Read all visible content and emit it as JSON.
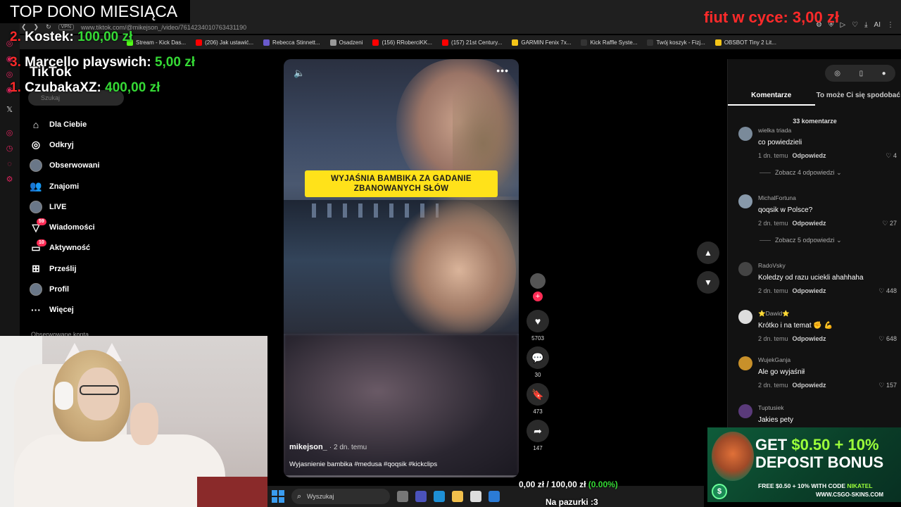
{
  "browser": {
    "url": "www.tiktok.com/@mikejson_/video/7614234010763431190",
    "vpn": "VPN",
    "bookmarks": [
      {
        "label": "Stream - Kick Das...",
        "color": "#53fc18"
      },
      {
        "label": "(206) Jak ustawić...",
        "color": "#ff0000"
      },
      {
        "label": "Rebecca Stinnett...",
        "color": "#6a5acd"
      },
      {
        "label": "Osadzeni",
        "color": "#999999"
      },
      {
        "label": "(156) RRoberciKK...",
        "color": "#ff0000"
      },
      {
        "label": "(157) 21st Century...",
        "color": "#ff0000"
      },
      {
        "label": "GARMIN Fenix 7x...",
        "color": "#f5c518"
      },
      {
        "label": "Kick Raffle Syste...",
        "color": "#333333"
      },
      {
        "label": "Twój koszyk - Fizj...",
        "color": "#333333"
      },
      {
        "label": "OBSBOT Tiny 2 Lit...",
        "color": "#f5c518"
      }
    ],
    "ai_label": "AI"
  },
  "overlay": {
    "title": "TOP DONO MIESIĄCA",
    "donors": [
      {
        "rank": "2.",
        "name": "Kostek:",
        "amount": "100,00 zł"
      },
      {
        "rank": "3.",
        "name": "Marcello playswich:",
        "amount": "5,00 zł"
      },
      {
        "rank": "1.",
        "name": "CzubakaXZ:",
        "amount": "400,00 zł"
      }
    ],
    "goal_top": "fiut w cyce: 3,00 zł",
    "goal_bottom": {
      "current": "0,00 zł",
      "target": "100,00 zł",
      "percent": "(0.00%)"
    },
    "pazurki": "Na pazurki :3"
  },
  "tiktok": {
    "logo": "TikTok",
    "search_placeholder": "Szukaj",
    "nav": [
      {
        "label": "Dla Ciebie",
        "icon": "home-icon"
      },
      {
        "label": "Odkryj",
        "icon": "compass-icon"
      },
      {
        "label": "Obserwowani",
        "icon": "following-avatar"
      },
      {
        "label": "Znajomi",
        "icon": "friends-icon"
      },
      {
        "label": "LIVE",
        "icon": "live-avatar"
      },
      {
        "label": "Wiadomości",
        "icon": "messages-icon",
        "badge": "59"
      },
      {
        "label": "Aktywność",
        "icon": "activity-icon",
        "badge": "10"
      },
      {
        "label": "Prześlij",
        "icon": "upload-icon"
      },
      {
        "label": "Profil",
        "icon": "profile-avatar"
      },
      {
        "label": "Więcej",
        "icon": "more-icon"
      }
    ],
    "followed_accounts": "Obserwowane konta"
  },
  "video": {
    "caption": "WYJAŚNIA BAMBIKA ZA GADANIE ZBANOWANYCH SŁÓW",
    "author": "mikejson_",
    "time": "· 2 dn. temu",
    "description": "Wyjasnienie bambika #medusa #qoqsik #kickclips",
    "progress": 0.01,
    "likes": "5703",
    "comments": "30",
    "saves": "473",
    "shares": "147"
  },
  "comments": {
    "tabs": [
      "Komentarze",
      "To może Ci się spodobać"
    ],
    "count": "33 komentarze",
    "reply_label": "Odpowiedz",
    "items": [
      {
        "user": "wielka triada",
        "text": "co powiedzieli",
        "time": "1 dn. temu",
        "likes": "4",
        "more": "Zobacz 4 odpowiedzi",
        "avatar": "#7a8a9a"
      },
      {
        "user": "MichalFortuna",
        "text": "qoqsik w Polsce?",
        "time": "2 dn. temu",
        "likes": "27",
        "more": "Zobacz 5 odpowiedzi",
        "avatar": "#8899aa"
      },
      {
        "user": "RadoVsky",
        "text": "Koledzy od razu uciekli ahahhaha",
        "time": "2 dn. temu",
        "likes": "448",
        "more": "",
        "avatar": "#444444"
      },
      {
        "user": "⭐Dawid⭐",
        "text": "Krótko i na temat ✊ 💪",
        "time": "2 dn. temu",
        "likes": "648",
        "more": "",
        "avatar": "#dddddd"
      },
      {
        "user": "WujekGanja",
        "text": "Ale go wyjaśnił",
        "time": "2 dn. temu",
        "likes": "157",
        "more": "",
        "avatar": "#c8902a"
      },
      {
        "user": "Tuptusiek",
        "text": "Jakies pety",
        "time": "",
        "likes": "",
        "more": "",
        "avatar": "#5a3a7a"
      }
    ]
  },
  "taskbar": {
    "search": "Wyszukaj"
  },
  "ad": {
    "line1_a": "GET ",
    "line1_b": "$0.50 + 10%",
    "line2": "DEPOSIT BONUS",
    "sub_a": "FREE $0.50 + 10% WITH CODE ",
    "sub_b": "NIKATEL",
    "url": "WWW.CSGO-SKINS.COM",
    "coin": "$"
  }
}
